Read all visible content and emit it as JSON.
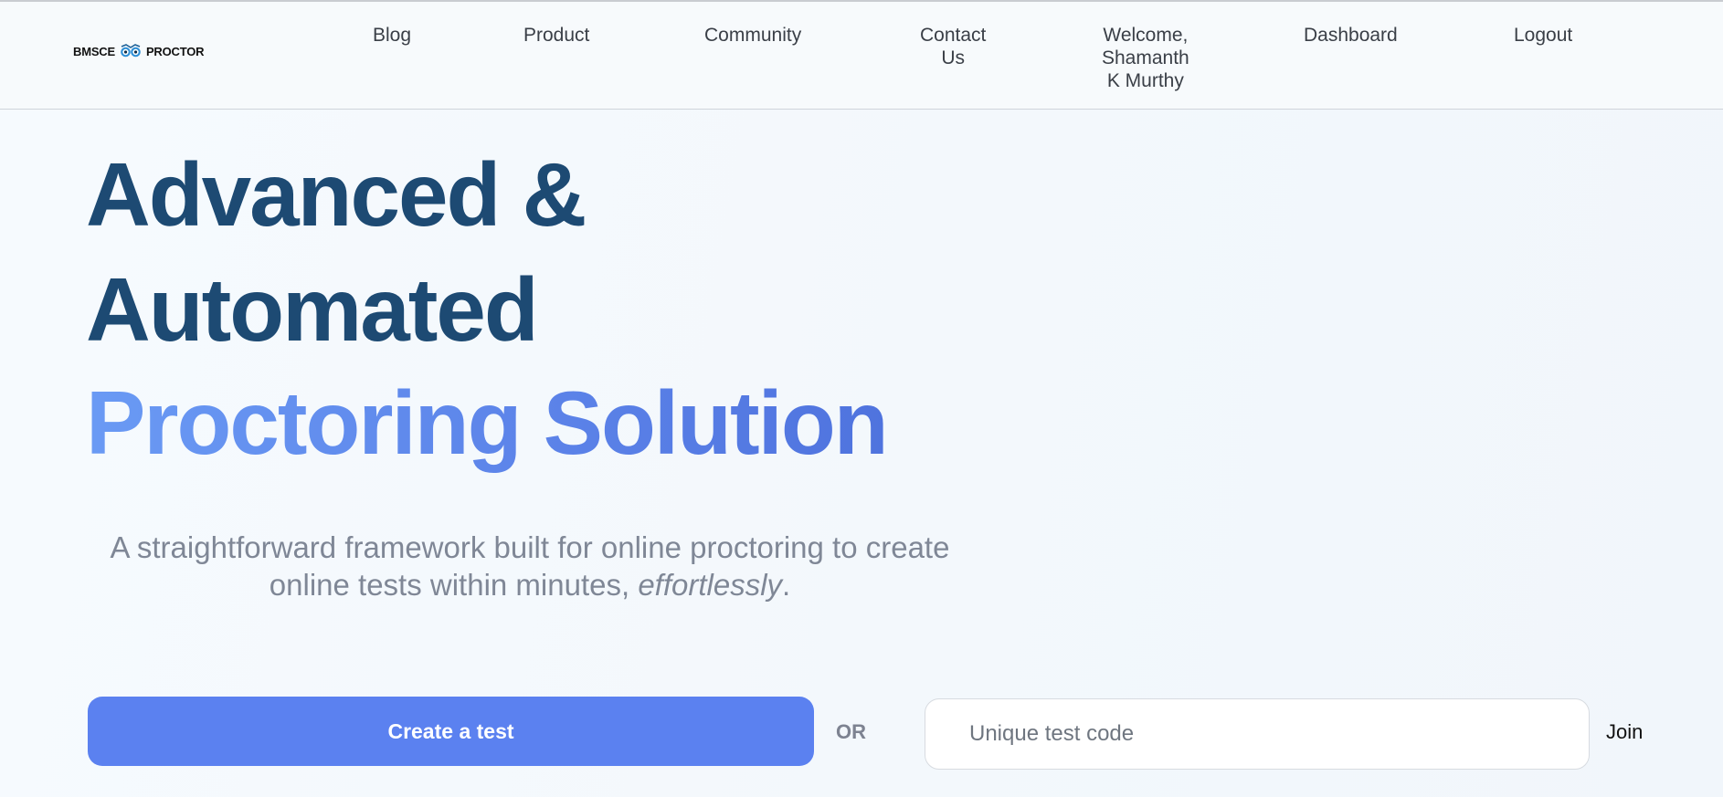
{
  "brand": {
    "left_text": "BMSCE",
    "right_text": "PROCTOR",
    "icon": "owl-eyes-icon",
    "accent_color": "#2f8fd6"
  },
  "nav": {
    "blog": "Blog",
    "product": "Product",
    "community": "Community",
    "contact_line1": "Contact",
    "contact_line2": "Us",
    "welcome_line1": "Welcome,",
    "welcome_line2": "Shamanth",
    "welcome_line3": "K Murthy",
    "dashboard": "Dashboard",
    "logout": "Logout"
  },
  "hero": {
    "line1": "Advanced &",
    "line2": "Automated",
    "line3": "Proctoring Solution",
    "subtitle_line1": "A straightforward framework built for online proctoring to create",
    "subtitle_line2_prefix": "online tests within minutes, ",
    "subtitle_emphasis": "effortlessly",
    "subtitle_suffix": "."
  },
  "actions": {
    "create_label": "Create a test",
    "or_label": "OR",
    "code_placeholder": "Unique test code",
    "join_label": "Join"
  },
  "colors": {
    "heading_dark": "#1d4a73",
    "heading_blue": "#5b82e8",
    "button_blue": "#5b81f0",
    "subtitle_gray": "#7f8796"
  }
}
